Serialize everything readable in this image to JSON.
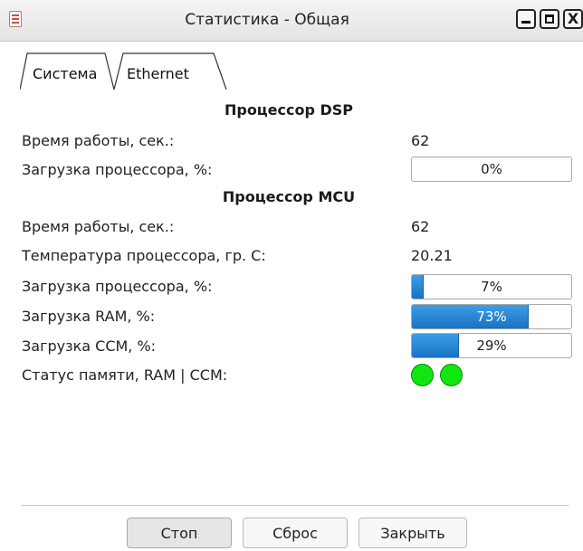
{
  "window": {
    "title": "Статистика - Общая",
    "close_glyph": "X"
  },
  "tabs": [
    {
      "label": "Система",
      "active": true
    },
    {
      "label": "Ethernet",
      "active": false
    }
  ],
  "dsp": {
    "heading": "Процессор DSP",
    "uptime_label": "Время работы, сек.:",
    "uptime_value": "62",
    "load_label": "Загрузка процессора, %:",
    "load_percent": 0,
    "load_text": "0%"
  },
  "mcu": {
    "heading": "Процессор MCU",
    "uptime_label": "Время работы, сек.:",
    "uptime_value": "62",
    "temp_label": "Температура процессора, гр. С:",
    "temp_value": "20.21",
    "load_label": "Загрузка процессора, %:",
    "load_percent": 7,
    "load_text": "7%",
    "ram_label": "Загрузка RAM, %:",
    "ram_percent": 73,
    "ram_text": "73%",
    "ccm_label": "Загрузка CCM, %:",
    "ccm_percent": 29,
    "ccm_text": "29%",
    "mem_status_label": "Статус памяти, RAM | CCM:",
    "ram_status_color": "#11e611",
    "ccm_status_color": "#11e611"
  },
  "buttons": {
    "stop": "Стоп",
    "reset": "Сброс",
    "close": "Закрыть"
  },
  "colors": {
    "progress_fill": "#1a72c4",
    "status_ok": "#11e611"
  }
}
